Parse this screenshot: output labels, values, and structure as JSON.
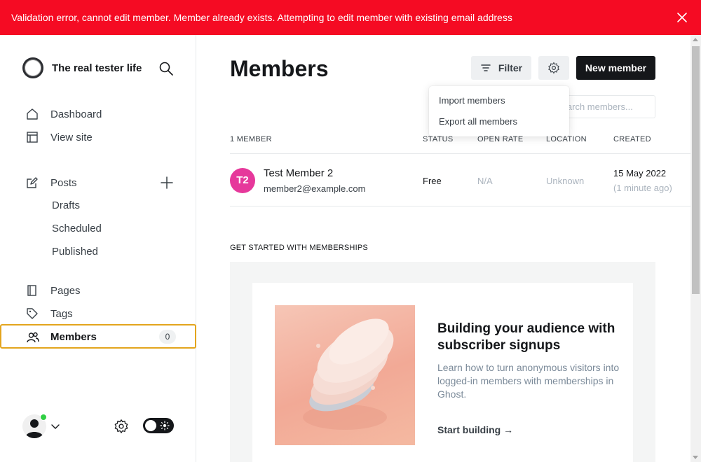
{
  "alert": {
    "message": "Validation error, cannot edit member. Member already exists. Attempting to edit member with existing email address",
    "icon": "close-icon"
  },
  "sidebar": {
    "site_name": "The real tester life",
    "nav": {
      "dashboard": "Dashboard",
      "view_site": "View site",
      "posts": "Posts",
      "drafts": "Drafts",
      "scheduled": "Scheduled",
      "published": "Published",
      "pages": "Pages",
      "tags": "Tags",
      "members": "Members"
    },
    "members_count": "0"
  },
  "header": {
    "title": "Members",
    "filter_label": "Filter",
    "new_member_label": "New member",
    "search_placeholder": "Search members..."
  },
  "actions_menu": {
    "import": "Import members",
    "export": "Export all members"
  },
  "table": {
    "headers": {
      "count": "1 MEMBER",
      "status": "STATUS",
      "open_rate": "OPEN RATE",
      "location": "LOCATION",
      "created": "CREATED"
    },
    "rows": [
      {
        "initials": "T2",
        "name": "Test Member 2",
        "email": "member2@example.com",
        "status": "Free",
        "open_rate": "N/A",
        "location": "Unknown",
        "created": "15 May 2022",
        "created_ago": "(1 minute ago)"
      }
    ]
  },
  "get_started": {
    "label": "GET STARTED WITH MEMBERSHIPS",
    "title": "Building your audience with subscriber signups",
    "description": "Learn how to turn anonymous visitors into logged-in members with memberships in Ghost.",
    "link": "Start building →"
  },
  "colors": {
    "alert_bg": "#f50b23",
    "accent_outline": "#e3a51d",
    "avatar_bg": "#e6389b",
    "online": "#30cf43"
  }
}
